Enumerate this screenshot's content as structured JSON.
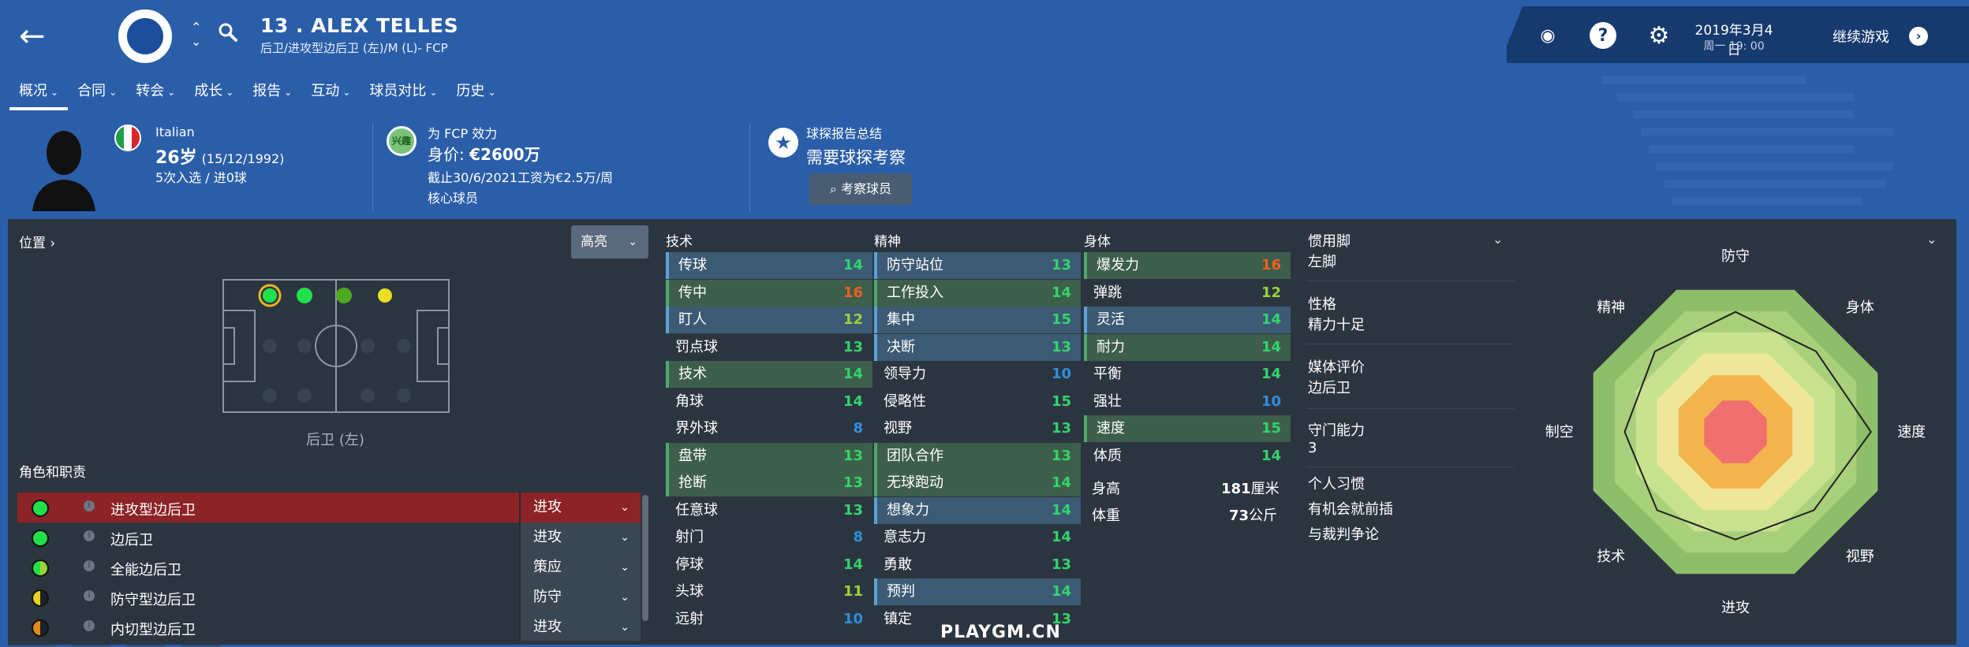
{
  "header": {
    "player_name": "13 . ALEX TELLES",
    "player_subtitle": "后卫/进攻型边后卫 (左)/M (L)- FCP",
    "date": "2019年3月4日",
    "time": "周一 19: 00",
    "continue_label": "继续游戏",
    "icons": [
      "back-arrow-icon",
      "club-badge-icon",
      "search-icon",
      "globe-icon",
      "help-icon",
      "gear-icon"
    ]
  },
  "tabs": [
    {
      "label": "概况",
      "active": true
    },
    {
      "label": "合同"
    },
    {
      "label": "转会"
    },
    {
      "label": "成长"
    },
    {
      "label": "报告"
    },
    {
      "label": "互动"
    },
    {
      "label": "球员对比"
    },
    {
      "label": "历史"
    }
  ],
  "info": {
    "nationality": "Italian",
    "age": "26岁",
    "dob": "(15/12/1992)",
    "caps": "5次入选 / 进0球",
    "club_badge_text": "兴趣",
    "plays_for": "为 FCP 效力",
    "value_label": "身价: ",
    "value": "€2600万",
    "contract": "截止30/6/2021工资为€2.5万/周",
    "squad_status": "核心球员",
    "scout_title": "球探报告总结",
    "scout_need": "需要球探考察",
    "scout_button": "考察球员"
  },
  "position": {
    "label": "位置 ›",
    "highlight": "高亮",
    "caption": "后卫 (左)"
  },
  "roles": {
    "title": "角色和职责",
    "items": [
      {
        "name": "进攻型边后卫",
        "duty": "进攻",
        "color": "#22e04a",
        "selected": true
      },
      {
        "name": "边后卫",
        "duty": "进攻",
        "color": "#22e04a"
      },
      {
        "name": "全能边后卫",
        "duty": "策应",
        "color": "half-green"
      },
      {
        "name": "防守型边后卫",
        "duty": "防守",
        "color": "half-yellow"
      },
      {
        "name": "内切型边后卫",
        "duty": "进攻",
        "color": "half-orange"
      }
    ]
  },
  "attributes": {
    "technical_title": "技术",
    "mental_title": "精神",
    "physical_title": "身体",
    "technical": [
      {
        "name": "传球",
        "value": "14",
        "hl": "blue"
      },
      {
        "name": "传中",
        "value": "16",
        "hl": "green"
      },
      {
        "name": "盯人",
        "value": "12",
        "hl": "blue"
      },
      {
        "name": "罚点球",
        "value": "13"
      },
      {
        "name": "技术",
        "value": "14",
        "hl": "green"
      },
      {
        "name": "角球",
        "value": "14"
      },
      {
        "name": "界外球",
        "value": "8"
      },
      {
        "name": "盘带",
        "value": "13",
        "hl": "green"
      },
      {
        "name": "抢断",
        "value": "13",
        "hl": "green"
      },
      {
        "name": "任意球",
        "value": "13"
      },
      {
        "name": "射门",
        "value": "8"
      },
      {
        "name": "停球",
        "value": "14"
      },
      {
        "name": "头球",
        "value": "11"
      },
      {
        "name": "远射",
        "value": "10"
      }
    ],
    "mental": [
      {
        "name": "防守站位",
        "value": "13",
        "hl": "blue"
      },
      {
        "name": "工作投入",
        "value": "14",
        "hl": "green"
      },
      {
        "name": "集中",
        "value": "15",
        "hl": "blue"
      },
      {
        "name": "决断",
        "value": "13",
        "hl": "blue"
      },
      {
        "name": "领导力",
        "value": "10"
      },
      {
        "name": "侵略性",
        "value": "15"
      },
      {
        "name": "视野",
        "value": "13"
      },
      {
        "name": "团队合作",
        "value": "13",
        "hl": "green"
      },
      {
        "name": "无球跑动",
        "value": "14",
        "hl": "green"
      },
      {
        "name": "想象力",
        "value": "14",
        "hl": "blue"
      },
      {
        "name": "意志力",
        "value": "14"
      },
      {
        "name": "勇敢",
        "value": "13"
      },
      {
        "name": "预判",
        "value": "14",
        "hl": "blue"
      },
      {
        "name": "镇定",
        "value": "13"
      }
    ],
    "physical": [
      {
        "name": "爆发力",
        "value": "16",
        "hl": "green"
      },
      {
        "name": "弹跳",
        "value": "12"
      },
      {
        "name": "灵活",
        "value": "14",
        "hl": "blue"
      },
      {
        "name": "耐力",
        "value": "14",
        "hl": "green"
      },
      {
        "name": "平衡",
        "value": "14"
      },
      {
        "name": "强壮",
        "value": "10"
      },
      {
        "name": "速度",
        "value": "15",
        "hl": "green"
      },
      {
        "name": "体质",
        "value": "14"
      }
    ],
    "height_label": "身高",
    "height_value": "181",
    "height_unit": "厘米",
    "weight_label": "体重",
    "weight_value": "73",
    "weight_unit": "公斤"
  },
  "side": {
    "foot_label": "惯用脚",
    "foot_value": "左脚",
    "personality_label": "性格",
    "personality_value": "精力十足",
    "media_label": "媒体评价",
    "media_value": "边后卫",
    "gk_label": "守门能力",
    "gk_value": "3",
    "habits_label": "个人习惯",
    "habit1": "有机会就前插",
    "habit2": "与裁判争论"
  },
  "radar": {
    "labels": [
      "防守",
      "身体",
      "速度",
      "视野",
      "进攻",
      "技术",
      "制空",
      "精神"
    ],
    "values": [
      0.78,
      0.74,
      0.88,
      0.72,
      0.7,
      0.72,
      0.72,
      0.74
    ]
  },
  "watermark": "PLAYGM.CN",
  "colors": {
    "header_blue": "#2a5ea8",
    "panel": "#2b3540",
    "selected_role": "#8c2326",
    "attr_high": "#31d56a",
    "attr_low": "#2f8fdb",
    "attr_top": "#f06020"
  }
}
